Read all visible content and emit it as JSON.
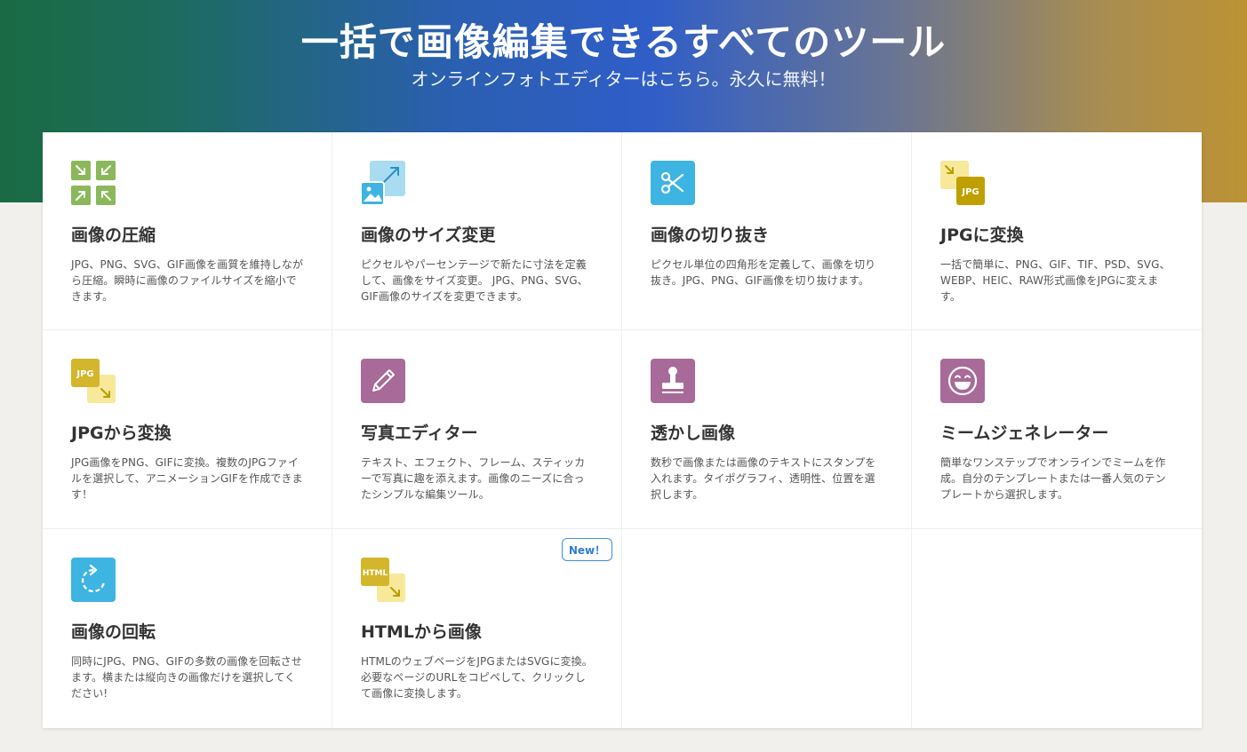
{
  "hero": {
    "title": "一括で画像編集できるすべてのツール",
    "subtitle": "オンラインフォトエディターはこちら。永久に無料！"
  },
  "tools": [
    {
      "title": "画像の圧縮",
      "description": "JPG、PNG、SVG、GIF画像を画質を維持しながら圧縮。瞬時に画像のファイルサイズを縮小できます。",
      "icon": "compress-arrows-icon",
      "color": "#8bb85a"
    },
    {
      "title": "画像のサイズ変更",
      "description": "ピクセルやパーセンテージで新たに寸法を定義して、画像をサイズ変更。 JPG、PNG、SVG、GIF画像のサイズを変更できます。",
      "icon": "resize-image-icon",
      "color": "#40b3e0"
    },
    {
      "title": "画像の切り抜き",
      "description": "ピクセル単位の四角形を定義して、画像を切り抜き。JPG、PNG、GIF画像を切り抜けます。",
      "icon": "scissors-icon",
      "color": "#3db4e2"
    },
    {
      "title": "JPGに変換",
      "description": "一括で簡単に、PNG、GIF、TIF、PSD、SVG、WEBP、HEIC、RAW形式画像をJPGに変えます。",
      "icon": "convert-to-jpg-icon",
      "color": "#c0a000",
      "icon_text": "JPG"
    },
    {
      "title": "JPGから変換",
      "description": "JPG画像をPNG、GIFに変換。複数のJPGファイルを選択して、アニメーションGIFを作成できます！",
      "icon": "convert-from-jpg-icon",
      "color": "#d3b62b",
      "icon_text": "JPG"
    },
    {
      "title": "写真エディター",
      "description": "テキスト、エフェクト、フレーム、スティッカーで写真に趣を添えます。画像のニーズに合ったシンプルな編集ツール。",
      "icon": "pencil-icon",
      "color": "#a86a98"
    },
    {
      "title": "透かし画像",
      "description": "数秒で画像または画像のテキストにスタンプを入れます。タイポグラフィ、透明性、位置を選択します。",
      "icon": "stamp-icon",
      "color": "#a86a98"
    },
    {
      "title": "ミームジェネレーター",
      "description": "簡単なワンステップでオンラインでミームを作成。自分のテンプレートまたは一番人気のテンプレートから選択します。",
      "icon": "laughing-face-icon",
      "color": "#a86a98"
    },
    {
      "title": "画像の回転",
      "description": "同時にJPG、PNG、GIFの多数の画像を回転させます。横または縦向きの画像だけを選択してください!",
      "icon": "rotate-icon",
      "color": "#3db4e2"
    },
    {
      "title": "HTMLから画像",
      "description": "HTMLのウェブページをJPGまたはSVGに変換。必要なページのURLをコピペして、クリックして画像に変換します。",
      "icon": "html-to-image-icon",
      "color": "#d3b62b",
      "icon_text": "HTML",
      "badge": "New！"
    }
  ]
}
